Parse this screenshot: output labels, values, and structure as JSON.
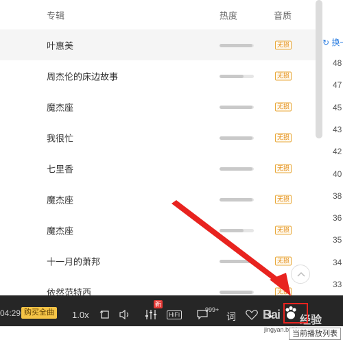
{
  "table": {
    "headers": {
      "album": "专辑",
      "heat": "热度",
      "quality": "音质"
    },
    "rows": [
      {
        "album": "叶惠美",
        "heat": 0.95,
        "quality": "无损",
        "highlighted": true
      },
      {
        "album": "周杰伦的床边故事",
        "heat": 0.7,
        "quality": "无损"
      },
      {
        "album": "魔杰座",
        "heat": 0.95,
        "quality": "无损"
      },
      {
        "album": "我很忙",
        "heat": 0.95,
        "quality": "无损"
      },
      {
        "album": "七里香",
        "heat": 0.95,
        "quality": "无损"
      },
      {
        "album": "魔杰座",
        "heat": 0.95,
        "quality": "无损"
      },
      {
        "album": "魔杰座",
        "heat": 0.7,
        "quality": "无损"
      },
      {
        "album": "十一月的萧邦",
        "heat": 0.95,
        "quality": "无损"
      },
      {
        "album": "依然范特西",
        "heat": 0.95,
        "quality": "无损"
      }
    ]
  },
  "right_panel": {
    "swap_label": "换一",
    "numbers": [
      "48",
      "47",
      "45",
      "43",
      "42",
      "40",
      "38",
      "36",
      "35",
      "34",
      "33"
    ]
  },
  "player": {
    "time": "04:29",
    "buy_label": "购买全曲",
    "speed": "1.0x",
    "new_badge": "新",
    "hifi": "HiFi",
    "comment_count": "999+",
    "lyrics_label": "词"
  },
  "tooltip": "当前播放列表",
  "watermark": {
    "brand": "Bai",
    "suffix": "经验",
    "sub": "jingyan.baidu.com"
  },
  "colors": {
    "accent_red": "#e8231f",
    "badge_orange": "#e38b12",
    "player_bg": "#262626"
  }
}
